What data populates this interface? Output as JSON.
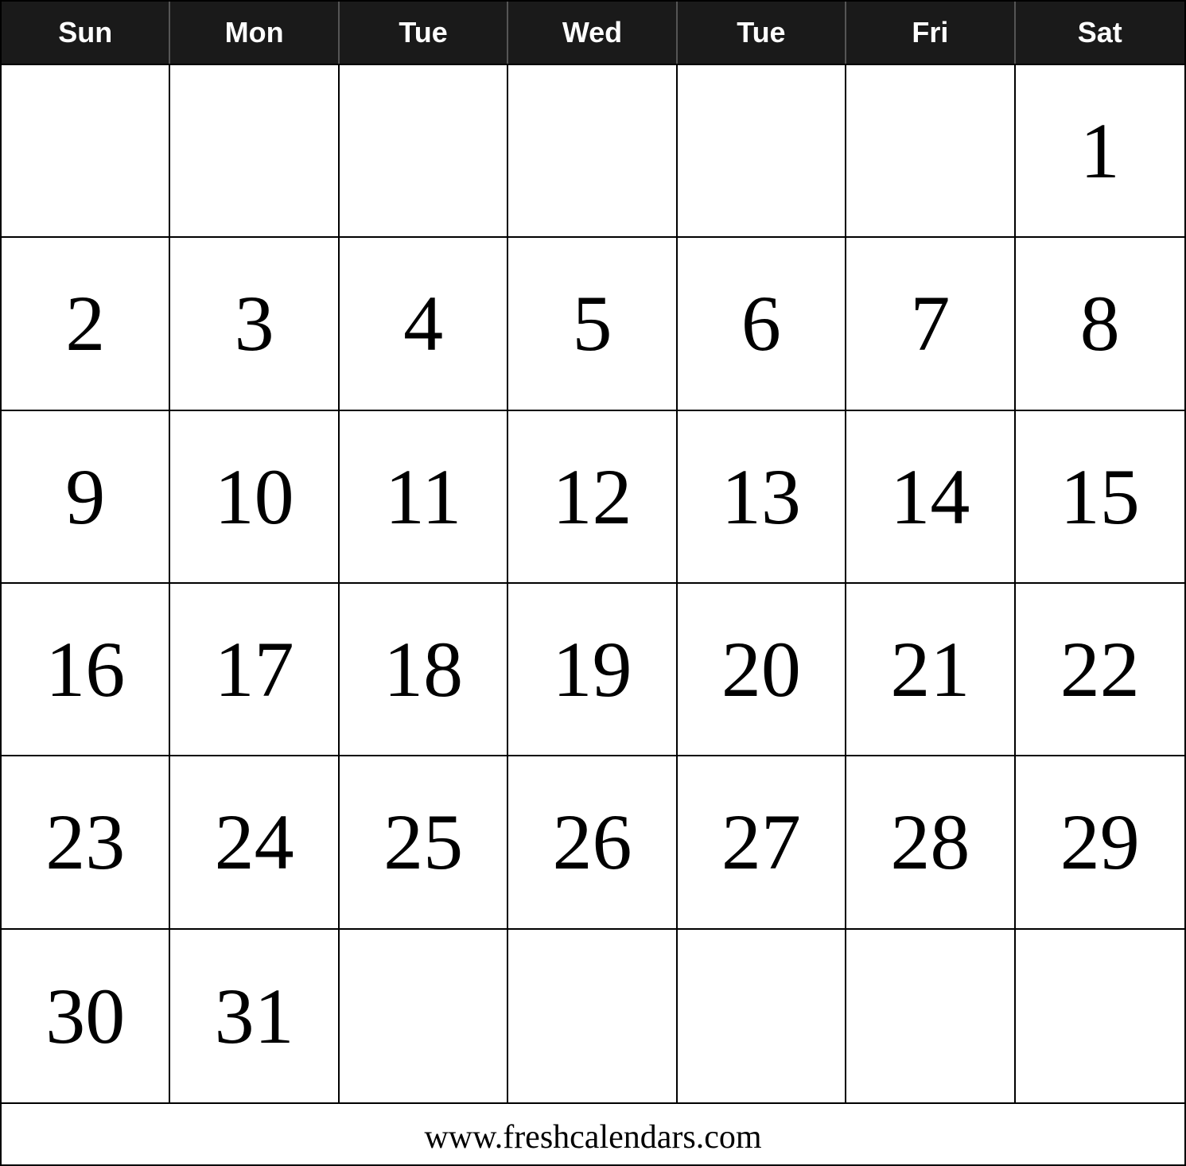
{
  "header": {
    "days": [
      "Sun",
      "Mon",
      "Tue",
      "Wed",
      "Tue",
      "Fri",
      "Sat"
    ]
  },
  "weeks": [
    [
      "",
      "",
      "",
      "",
      "",
      "",
      "1"
    ],
    [
      "2",
      "3",
      "4",
      "5",
      "6",
      "7",
      "8"
    ],
    [
      "9",
      "10",
      "11",
      "12",
      "13",
      "14",
      "15"
    ],
    [
      "16",
      "17",
      "18",
      "19",
      "20",
      "21",
      "22"
    ],
    [
      "23",
      "24",
      "25",
      "26",
      "27",
      "28",
      "29"
    ],
    [
      "30",
      "31",
      "",
      "",
      "",
      "",
      ""
    ]
  ],
  "footer": {
    "url": "www.freshcalendars.com"
  }
}
